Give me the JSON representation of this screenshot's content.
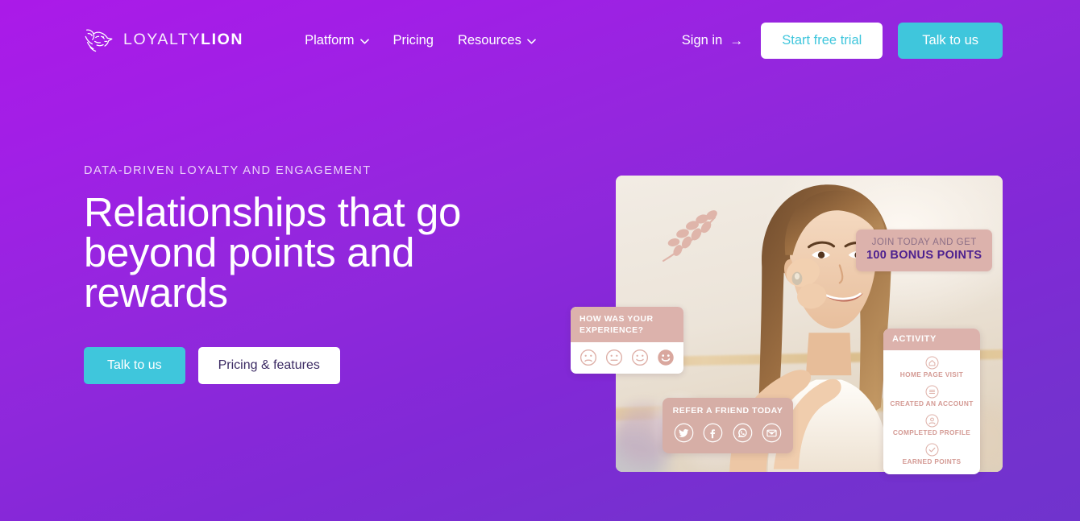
{
  "brand": {
    "name_light": "LOYALTY",
    "name_bold": "LION",
    "logo_icon": "lion-head-icon"
  },
  "header": {
    "nav": [
      {
        "label": "Platform",
        "has_dropdown": true,
        "icon": "chevron-down-icon"
      },
      {
        "label": "Pricing",
        "has_dropdown": false,
        "icon": ""
      },
      {
        "label": "Resources",
        "has_dropdown": true,
        "icon": "chevron-down-icon"
      }
    ],
    "sign_in": {
      "label": "Sign in",
      "arrow": "→",
      "icon": "arrow-right-icon"
    },
    "start_trial": "Start free trial",
    "talk_to_us": "Talk to us"
  },
  "hero": {
    "eyebrow": "DATA-DRIVEN LOYALTY AND ENGAGEMENT",
    "title": "Relationships that go beyond points and rewards",
    "cta_primary": "Talk to us",
    "cta_secondary": "Pricing & features"
  },
  "hero_art": {
    "photo_alt": "Smiling woman putting on an earring",
    "join_card": {
      "line1": "JOIN TODAY AND GET",
      "line2": "100 BONUS POINTS"
    },
    "experience_card": {
      "title": "HOW WAS YOUR EXPERIENCE?",
      "faces": [
        {
          "name": "face-sad-icon",
          "selected": false
        },
        {
          "name": "face-neutral-icon",
          "selected": false
        },
        {
          "name": "face-smile-icon",
          "selected": false
        },
        {
          "name": "face-happy-icon",
          "selected": true
        }
      ]
    },
    "refer_card": {
      "title": "REFER A FRIEND TODAY",
      "socials": [
        {
          "name": "twitter-icon"
        },
        {
          "name": "facebook-icon"
        },
        {
          "name": "whatsapp-icon"
        },
        {
          "name": "email-icon"
        }
      ]
    },
    "activity_card": {
      "title": "ACTIVITY",
      "items": [
        {
          "label": "HOME PAGE VISIT",
          "icon": "home-icon"
        },
        {
          "label": "CREATED AN ACCOUNT",
          "icon": "list-icon"
        },
        {
          "label": "COMPLETED PROFILE",
          "icon": "person-icon"
        },
        {
          "label": "EARNED POINTS",
          "icon": "check-circle-icon"
        }
      ]
    }
  },
  "colors": {
    "bg_top": "#ab1ae8",
    "bg_bottom": "#7033cd",
    "accent_cyan": "#3fc6dc",
    "card_pink": "#dcb2ac",
    "card_pink_deep": "#d6aea6",
    "bonus_purple": "#4b1f8f",
    "text_dark_purple": "#3b2a63"
  }
}
